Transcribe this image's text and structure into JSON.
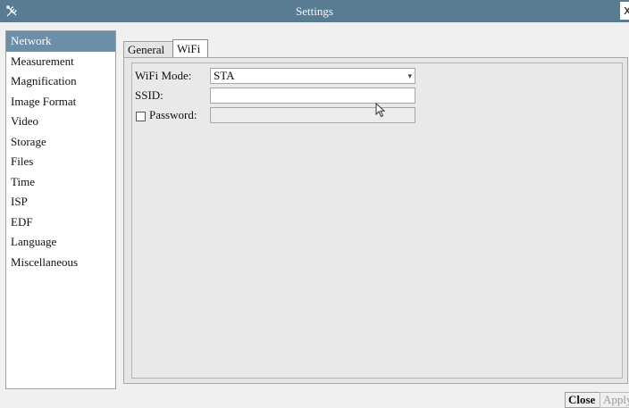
{
  "window": {
    "title": "Settings",
    "close_glyph": "x"
  },
  "icons": {
    "app": "tools-icon",
    "close": "close-icon"
  },
  "colors": {
    "titlebar": "#5a7c93",
    "selected": "#6c8fa8"
  },
  "sidebar": {
    "selected_index": 0,
    "items": [
      {
        "label": "Network"
      },
      {
        "label": "Measurement"
      },
      {
        "label": "Magnification"
      },
      {
        "label": "Image Format"
      },
      {
        "label": "Video"
      },
      {
        "label": "Storage"
      },
      {
        "label": "Files"
      },
      {
        "label": "Time"
      },
      {
        "label": "ISP"
      },
      {
        "label": "EDF"
      },
      {
        "label": "Language"
      },
      {
        "label": "Miscellaneous"
      }
    ]
  },
  "tabs": {
    "general": "General",
    "wifi": "WiFi",
    "active": "WiFi"
  },
  "wifi": {
    "mode_label": "WiFi Mode:",
    "mode_value": "STA",
    "ssid_label": "SSID:",
    "ssid_value": "",
    "password_label": "Password:",
    "password_checked": false,
    "password_value": ""
  },
  "buttons": {
    "close": "Close",
    "apply": "Apply"
  }
}
